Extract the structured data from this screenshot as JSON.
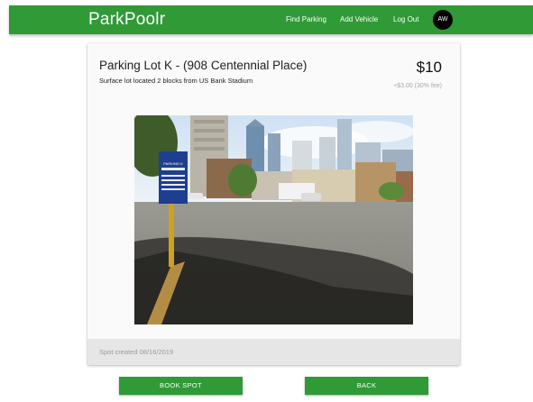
{
  "app": {
    "brand": "ParkPoolr"
  },
  "nav": {
    "find_parking": "Find Parking",
    "add_vehicle": "Add Vehicle",
    "log_out": "Log Out",
    "avatar_initials": "AW"
  },
  "listing": {
    "title": "Parking Lot K - (908 Centennial Place)",
    "description": "Surface lot located 2 blocks from US Bank Stadium",
    "price": "$10",
    "fee_note": "+$3.00 (30% fee)",
    "photo_sign_text": "PARKING K",
    "created": "Spot created 08/16/2019"
  },
  "actions": {
    "book": "BOOK SPOT",
    "back": "BACK"
  },
  "colors": {
    "primary": "#2f9a36",
    "card_bg": "#fafafa",
    "footer_bg": "#e6e6e6",
    "avatar_bg": "#000000"
  }
}
